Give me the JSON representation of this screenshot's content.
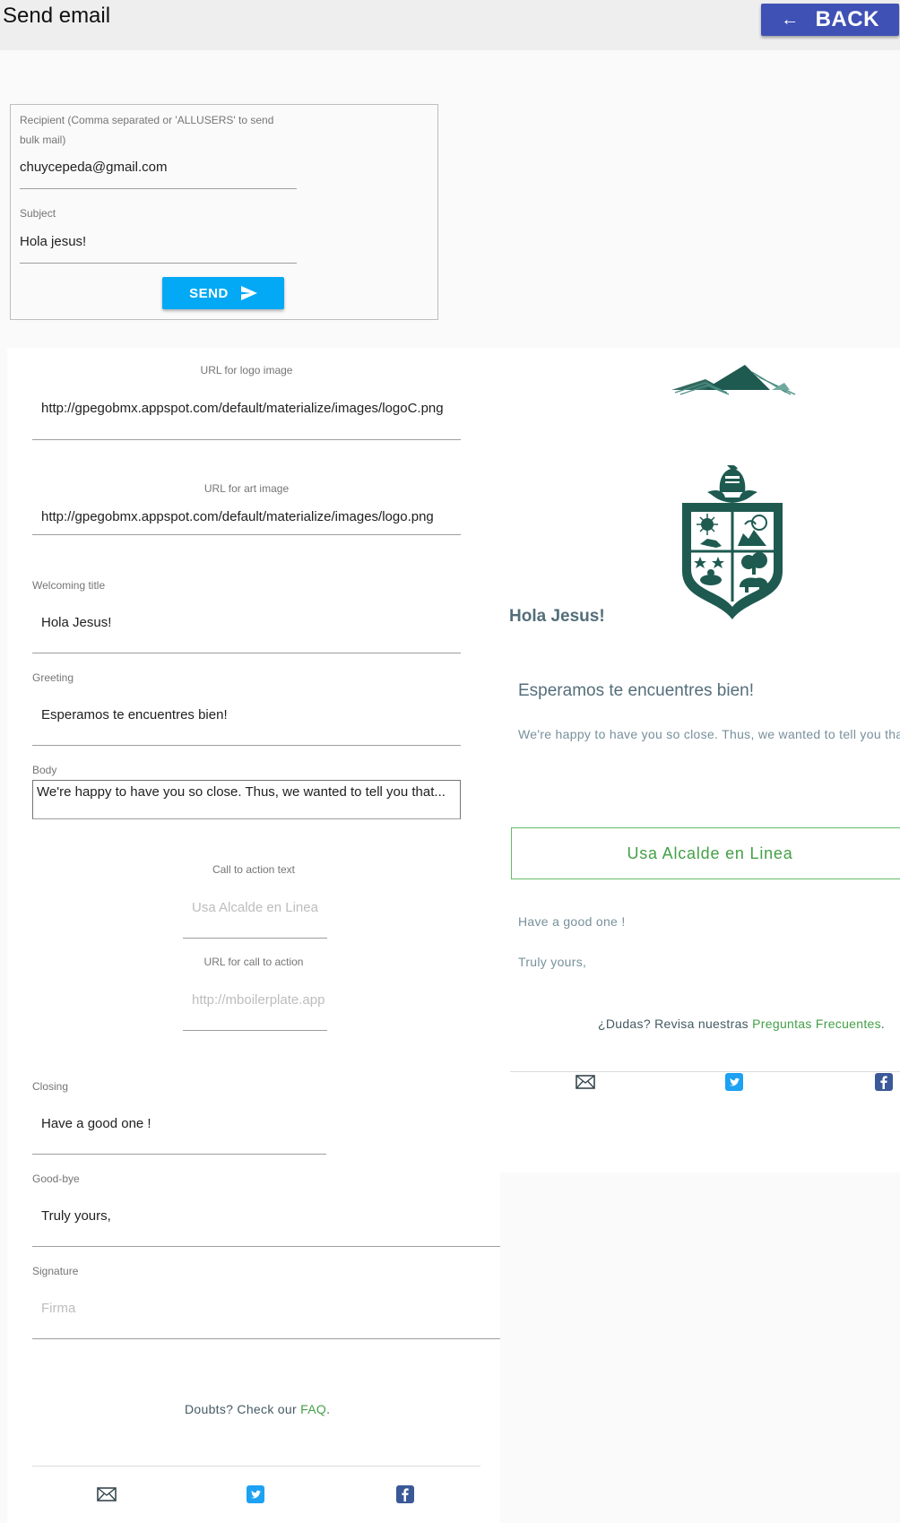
{
  "header": {
    "title": "Send email",
    "back_label": "BACK"
  },
  "send_form": {
    "recipient_label": "Recipient (Comma separated or 'ALLUSERS' to send bulk mail)",
    "recipient_value": "chuycepeda@gmail.com",
    "subject_label": "Subject",
    "subject_value": "Hola jesus!",
    "send_label": "SEND"
  },
  "editor": {
    "logo_url_label": "URL for logo image",
    "logo_url_value": "http://gpegobmx.appspot.com/default/materialize/images/logoC.png",
    "art_url_label": "URL for art image",
    "art_url_value": "http://gpegobmx.appspot.com/default/materialize/images/logo.png",
    "welcome_label": "Welcoming title",
    "welcome_value": "Hola Jesus!",
    "greeting_label": "Greeting",
    "greeting_value": "Esperamos te encuentres bien!",
    "body_label": "Body",
    "body_value": "We're happy to have you so close. Thus, we wanted to tell you that...",
    "cta_text_label": "Call to action text",
    "cta_text_placeholder": "Usa Alcalde en Linea",
    "cta_url_label": "URL for call to action",
    "cta_url_placeholder": "http://mboilerplate.appspot.com",
    "closing_label": "Closing",
    "closing_value": "Have a good one !",
    "goodbye_label": "Good-bye",
    "goodbye_value": "Truly yours,",
    "signature_label": "Signature",
    "signature_placeholder": "Firma",
    "faq_prefix": "Doubts? Check our ",
    "faq_link": "FAQ",
    "faq_suffix": "."
  },
  "preview": {
    "title": "Hola Jesus!",
    "greeting": "Esperamos te encuentres bien!",
    "body": "We're happy to have you so close. Thus, we wanted to tell you that...",
    "cta": "Usa Alcalde en Linea",
    "closing": "Have a good one !",
    "goodbye": "Truly yours,",
    "faq_prefix": "¿Dudas? Revisa nuestras ",
    "faq_link": "Preguntas Frecuentes",
    "faq_suffix": "."
  },
  "colors": {
    "primary": "#3f51b5",
    "send": "#03a9f4",
    "brand_green": "#1e5a50",
    "link_green": "#43a047",
    "twitter": "#1da1f2",
    "facebook": "#3b5998"
  },
  "icons": [
    "arrow-back-icon",
    "send-icon",
    "mail-icon",
    "twitter-icon",
    "facebook-icon",
    "mountain-logo",
    "coat-of-arms"
  ]
}
